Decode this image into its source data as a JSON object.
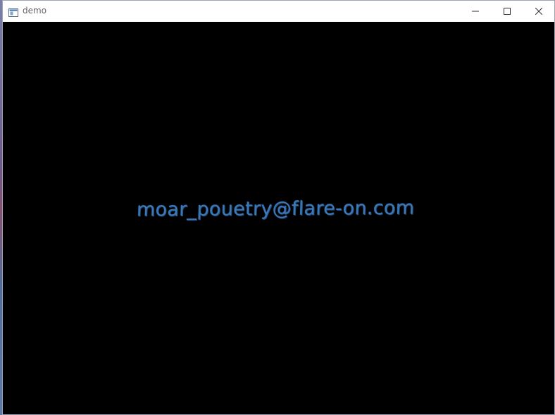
{
  "window": {
    "title": "demo",
    "icons": {
      "app": "window-app-icon",
      "minimize": "minimize-icon",
      "maximize": "maximize-icon",
      "close": "close-icon"
    }
  },
  "client": {
    "rendered_text": "moar_pouetry@flare-on.com",
    "background_color": "#000000",
    "text_color": "#3a78b8"
  }
}
